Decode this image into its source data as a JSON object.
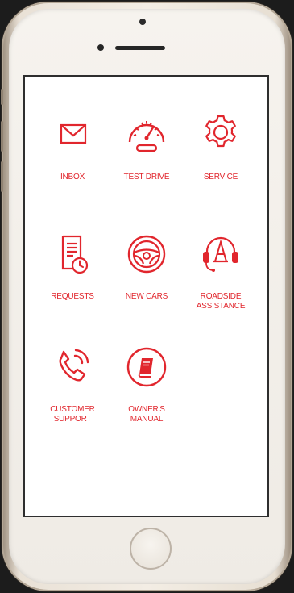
{
  "accent": "#e1262d",
  "apps": {
    "inbox": {
      "label": "INBOX",
      "icon": "envelope-icon"
    },
    "test_drive": {
      "label": "TEST DRIVE",
      "icon": "speedometer-icon"
    },
    "service": {
      "label": "SERVICE",
      "icon": "gear-icon"
    },
    "requests": {
      "label": "REQUESTS",
      "icon": "document-clock-icon"
    },
    "new_cars": {
      "label": "NEW CARS",
      "icon": "steering-wheel-icon"
    },
    "roadside": {
      "label": "ROADSIDE\nASSISTANCE",
      "icon": "headset-cone-icon"
    },
    "customer_support": {
      "label": "CUSTOMER\nSUPPORT",
      "icon": "phone-call-icon"
    },
    "owners_manual": {
      "label": "OWNER'S\nMANUAL",
      "icon": "book-icon"
    }
  }
}
